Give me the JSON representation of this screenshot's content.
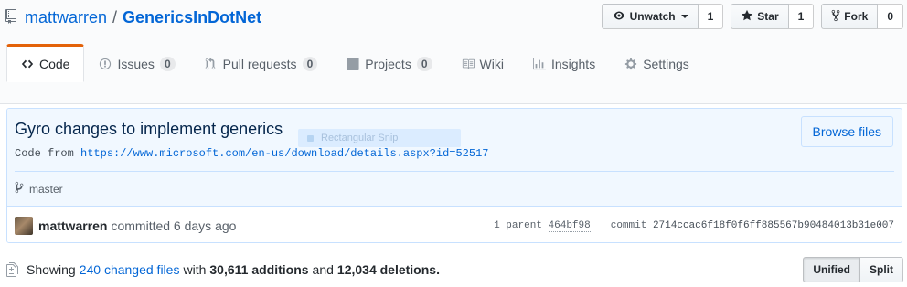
{
  "repo": {
    "owner": "mattwarren",
    "separator": "/",
    "name": "GenericsInDotNet"
  },
  "actions": {
    "watch": {
      "label": "Unwatch",
      "count": "1"
    },
    "star": {
      "label": "Star",
      "count": "1"
    },
    "fork": {
      "label": "Fork",
      "count": "0"
    }
  },
  "nav": {
    "code": "Code",
    "issues": {
      "label": "Issues",
      "count": "0"
    },
    "pulls": {
      "label": "Pull requests",
      "count": "0"
    },
    "projects": {
      "label": "Projects",
      "count": "0"
    },
    "wiki": "Wiki",
    "insights": "Insights",
    "settings": "Settings"
  },
  "commit": {
    "title": "Gyro changes to implement generics",
    "desc_prefix": "Code from ",
    "desc_link": "https://www.microsoft.com/en-us/download/details.aspx?id=52517",
    "browse_label": "Browse files",
    "branch": "master",
    "author": "mattwarren",
    "committed_text": "committed 6 days ago",
    "parent_label": "1 parent",
    "parent_sha": "464bf98",
    "commit_label": "commit",
    "sha": "2714ccac6f18f0f6ff885567b90484013b31e007"
  },
  "overlay": {
    "snip_label": "Rectangular Snip"
  },
  "toc": {
    "showing": "Showing",
    "changed_files": "240 changed files",
    "with": "with",
    "additions": "30,611 additions",
    "and": "and",
    "deletions": "12,034 deletions."
  },
  "view": {
    "unified": "Unified",
    "split": "Split"
  }
}
